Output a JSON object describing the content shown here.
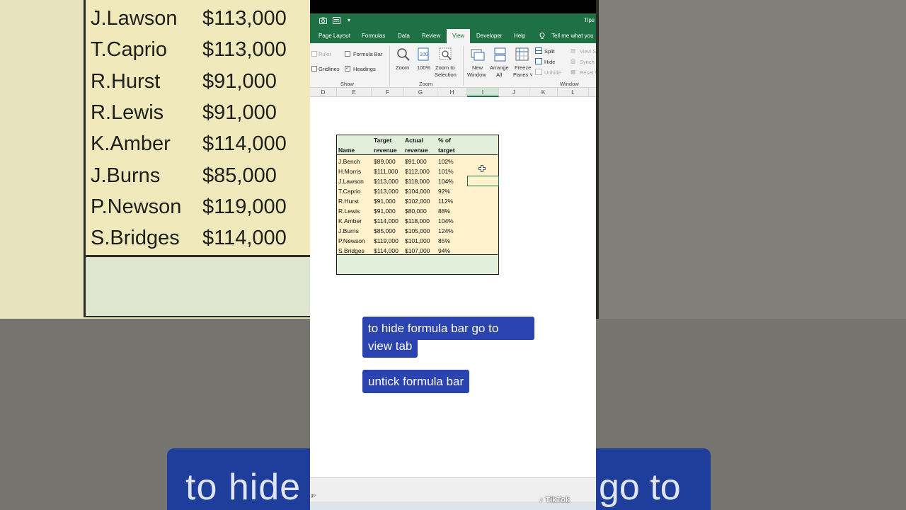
{
  "background": {
    "names": [
      "J.Lawson",
      "T.Caprio",
      "R.Hurst",
      "R.Lewis",
      "K.Amber",
      "J.Burns",
      "P.Newson",
      "S.Bridges"
    ],
    "values": [
      "$113,000",
      "$113,000",
      "$91,000",
      "$91,000",
      "$114,000",
      "$85,000",
      "$119,000",
      "$114,000"
    ],
    "banner_left": "to hide",
    "banner_right": "go to"
  },
  "qat": {
    "tips": "Tips"
  },
  "tabs": [
    "Page Layout",
    "Formulas",
    "Data",
    "Review",
    "View",
    "Developer",
    "Help",
    "Tell me what you"
  ],
  "active_tab": "View",
  "ribbon": {
    "show": {
      "label": "Show",
      "ruler": "Ruler",
      "formula_bar": "Formula Bar",
      "gridlines": "Gridlines",
      "headings": "Headings",
      "headings_check": "✓"
    },
    "zoom": {
      "label": "Zoom",
      "zoom": "Zoom",
      "hundred": "100%",
      "zoom_to_1": "Zoom to",
      "zoom_to_2": "Selection"
    },
    "window": {
      "label": "Window",
      "new_1": "New",
      "new_2": "Window",
      "arrange_1": "Arrange",
      "arrange_2": "All",
      "freeze_1": "Freeze",
      "freeze_2": "Panes ˅",
      "split": "Split",
      "hide": "Hide",
      "unhide": "Unhide",
      "view_side": "View S",
      "synch": "Synch",
      "reset": "Reset W"
    }
  },
  "columns": [
    "D",
    "E",
    "F",
    "G",
    "H",
    "I",
    "J",
    "K",
    "L"
  ],
  "table": {
    "headers": {
      "name": "Name",
      "target_1": "Target",
      "target_2": "revenue",
      "actual_1": "Actual",
      "actual_2": "revenue",
      "pct_1": "% of",
      "pct_2": "target"
    },
    "rows": [
      [
        "J.Bench",
        "$89,000",
        "$91,000",
        "102%"
      ],
      [
        "H.Morris",
        "$111,000",
        "$112,000",
        "101%"
      ],
      [
        "J.Lawson",
        "$113,000",
        "$118,000",
        "104%"
      ],
      [
        "T.Caprio",
        "$113,000",
        "$104,000",
        "92%"
      ],
      [
        "R.Hurst",
        "$91,000",
        "$102,000",
        "112%"
      ],
      [
        "R.Lewis",
        "$91,000",
        "$80,000",
        "88%"
      ],
      [
        "K.Amber",
        "$114,000",
        "$118,000",
        "104%"
      ],
      [
        "J.Burns",
        "$85,000",
        "$105,000",
        "124%"
      ],
      [
        "P.Newson",
        "$119,000",
        "$101,000",
        "85%"
      ],
      [
        "S.Bridges",
        "$114,000",
        "$107,000",
        "94%"
      ]
    ]
  },
  "captions": {
    "line1": "to hide formula bar go to",
    "line2": "view tab",
    "line3": "untick formula bar"
  },
  "status": {
    "mini": "go"
  },
  "watermark": "TikTok",
  "colors": {
    "excel_green": "#1e7145",
    "caption_blue": "#2a43b0",
    "header_fill": "#e2efda",
    "body_fill": "#fff2cc"
  }
}
